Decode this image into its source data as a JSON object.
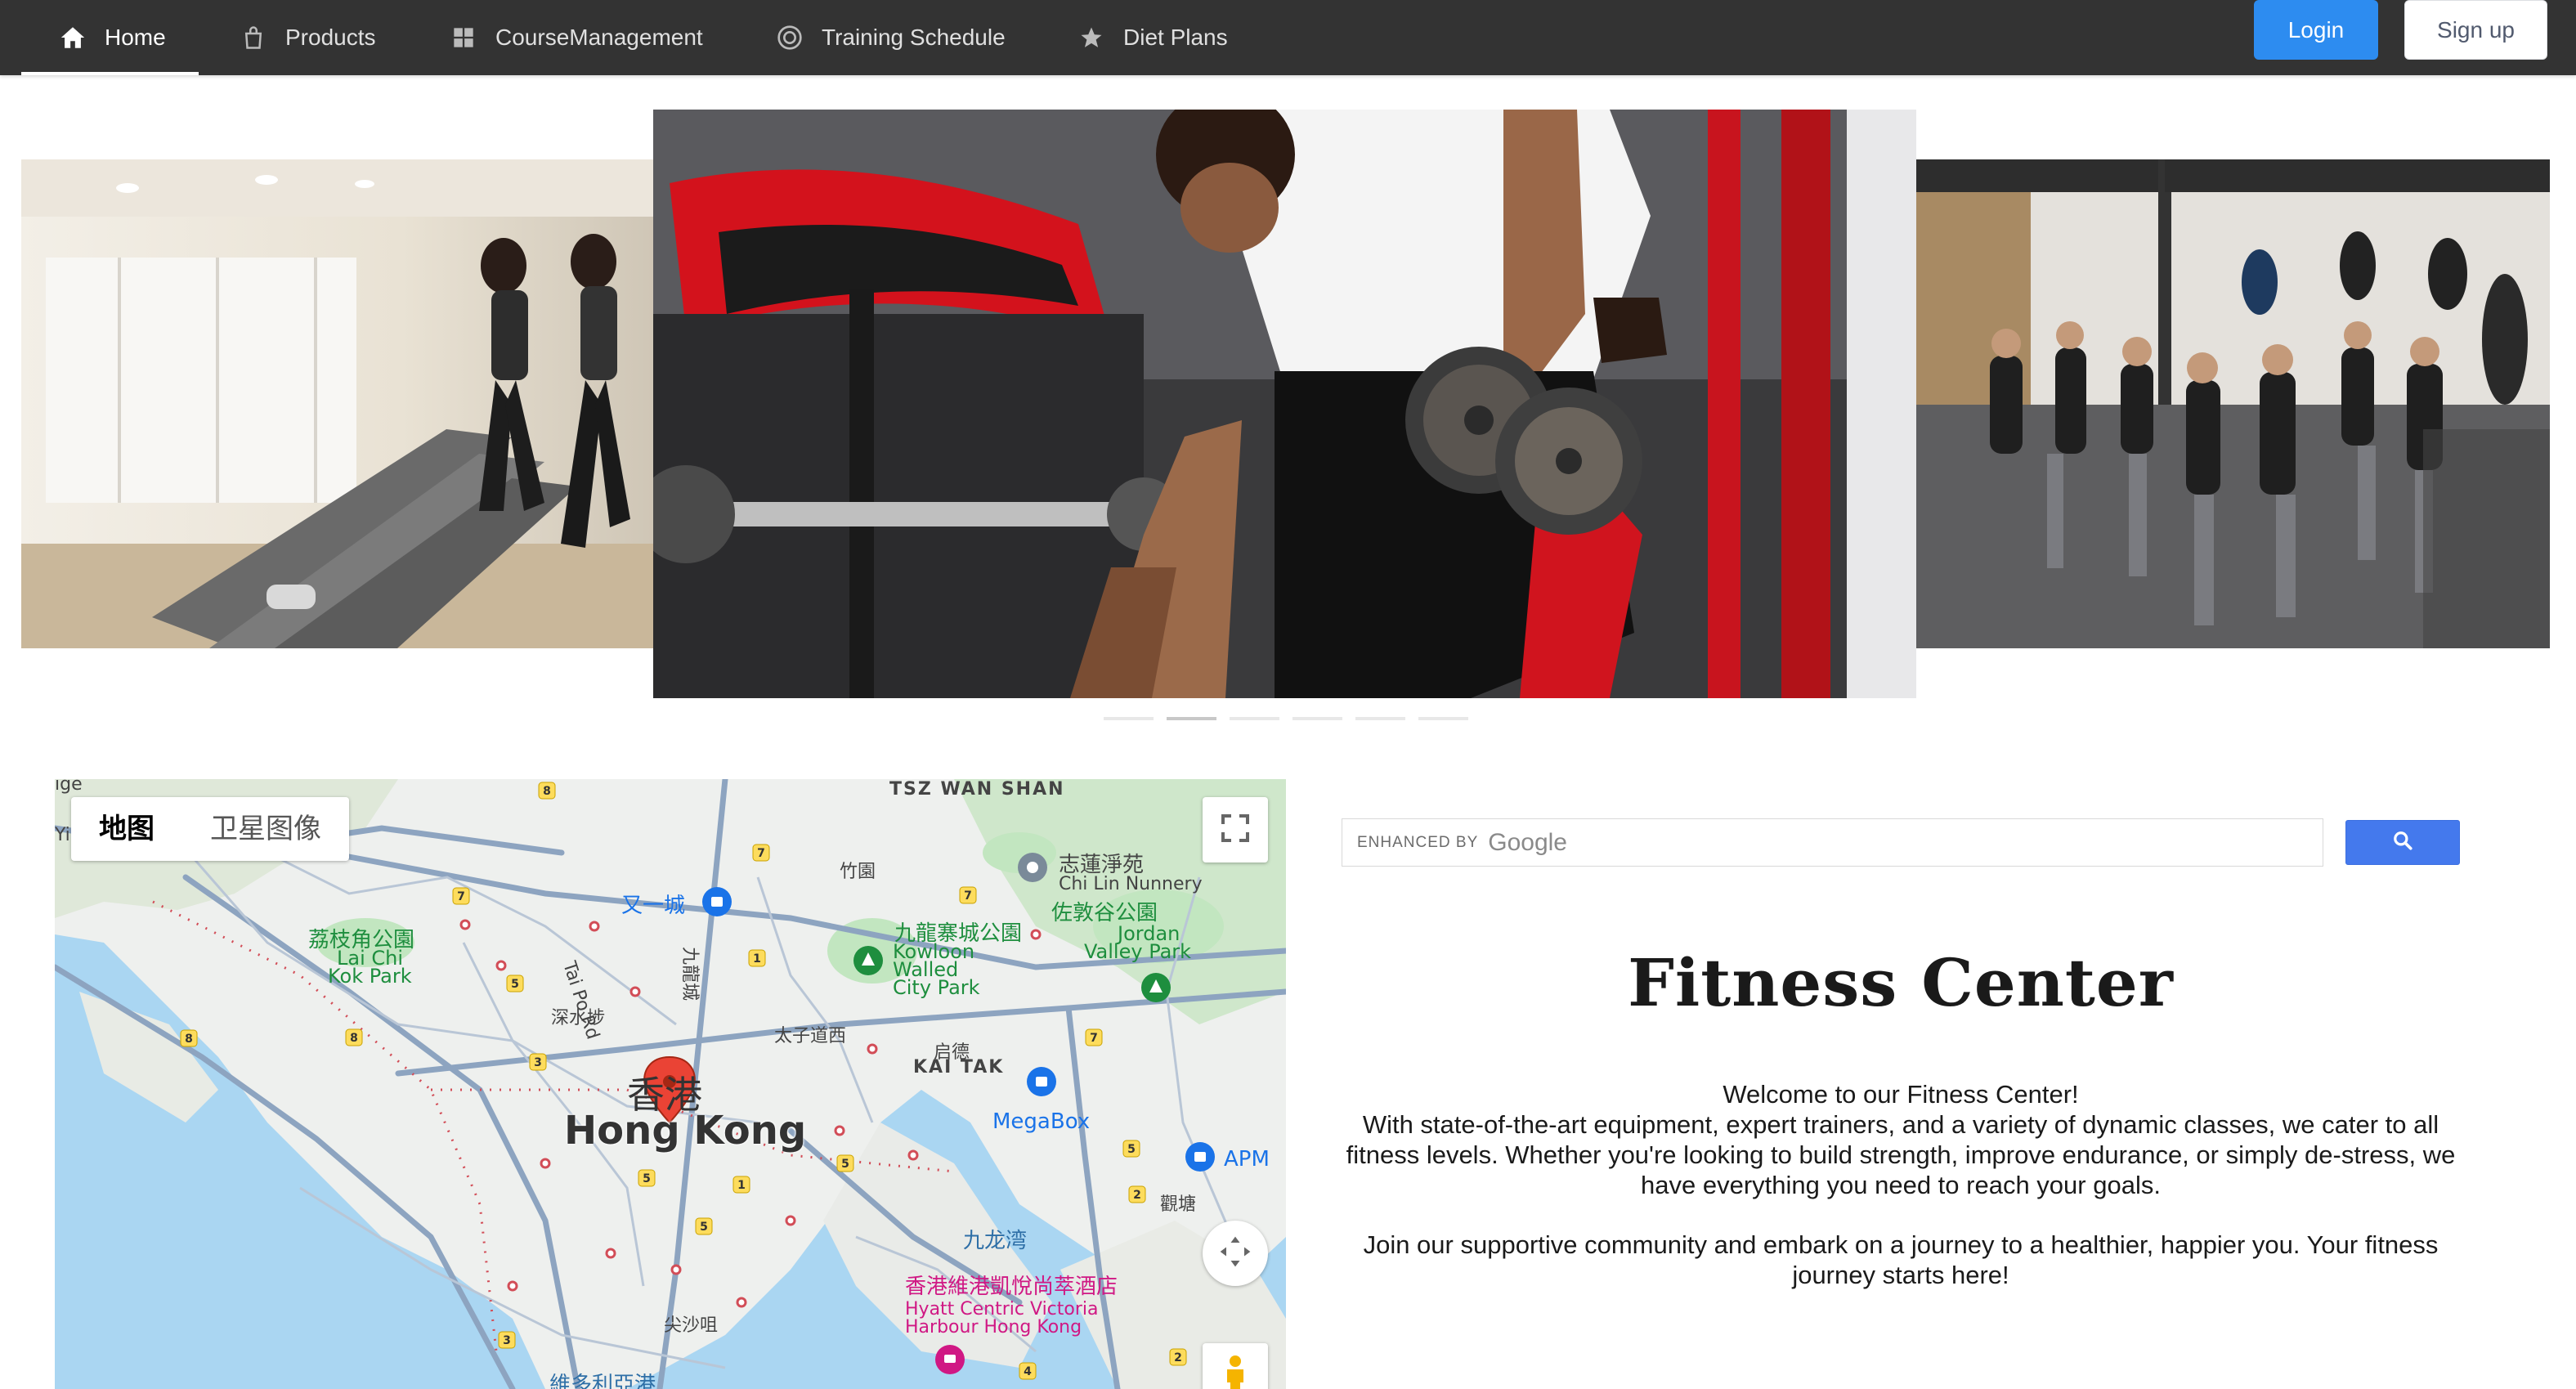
{
  "nav": {
    "items": [
      {
        "label": "Home",
        "icon": "home-icon",
        "active": true
      },
      {
        "label": "Products",
        "icon": "bag-icon",
        "active": false
      },
      {
        "label": "CourseManagement",
        "icon": "grid-icon",
        "active": false
      },
      {
        "label": "Training Schedule",
        "icon": "aperture-icon",
        "active": false
      },
      {
        "label": "Diet Plans",
        "icon": "star-icon",
        "active": false
      }
    ],
    "login_label": "Login",
    "signup_label": "Sign up"
  },
  "carousel": {
    "slides": [
      "treadmill-runners-image",
      "dumbbell-row-image",
      "kickboxing-class-image"
    ],
    "dot_count": 6,
    "active_index": 1
  },
  "map": {
    "type_map": "地图",
    "type_satellite": "卫星图像",
    "city_cn": "香港",
    "city_en": "Hong Kong",
    "labels": {
      "tsz_wan_shan": "TSZ WAN SHAN",
      "chi_lin_cn": "志蓮淨苑",
      "chi_lin_en": "Chi Lin Nunnery",
      "jordan_valley_cn": "佐敦谷公園",
      "jordan_valley_en1": "Jordan",
      "jordan_valley_en2": "Valley Park",
      "lai_chi_kok_cn": "荔枝角公園",
      "lai_chi_kok_en1": "Lai Chi",
      "lai_chi_kok_en2": "Kok Park",
      "kowloon_walled_cn": "九龍寨城公園",
      "kowloon_walled_en1": "Kowloon",
      "kowloon_walled_en2": "Walled",
      "kowloon_walled_en3": "City Park",
      "yau_yat": "又一城",
      "tai_po_rd": "Tai Po Rd",
      "sham_shui_po": "深水埗",
      "tai_tsz_west": "太子道西",
      "kai_tak_cn": "启德",
      "kai_tak_en": "KAI TAK",
      "megabox": "MegaBox",
      "apm": "APM",
      "kwun_tong": "觀塘",
      "kowloon_bay": "九龙湾",
      "hyatt_cn": "香港維港凱悅尚萃酒店",
      "hyatt_en1": "Hyatt Centric Victoria",
      "hyatt_en2": "Harbour Hong Kong",
      "tst": "尖沙咀",
      "victoria": "維多利亞港",
      "bamboo_garden": "竹園",
      "kowloon_city": "九龍城",
      "edge_yi": "Yi",
      "edge_ige": "ige"
    }
  },
  "search": {
    "enhanced_by": "ENHANCED BY",
    "google": "Google"
  },
  "content": {
    "title": "Fitness Center",
    "welcome": "Welcome to our Fitness Center!",
    "body": "With state-of-the-art equipment, expert trainers, and a variety of dynamic classes, we cater to all fitness levels. Whether you're looking to build strength, improve endurance, or simply de-stress, we have everything you need to reach your goals.",
    "join": "Join our supportive community and embark on a journey to a healthier, happier you. Your fitness journey starts here!"
  }
}
